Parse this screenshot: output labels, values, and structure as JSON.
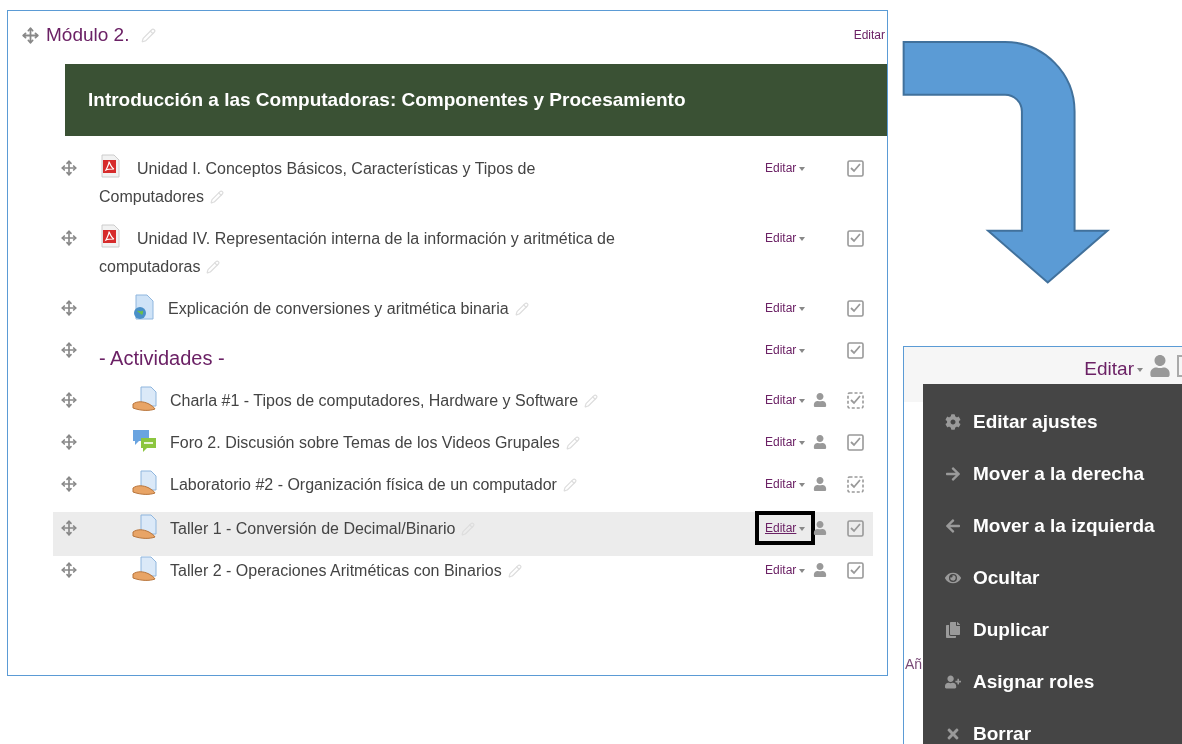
{
  "left_panel": {
    "section_title": "Módulo 2.",
    "edit_link": "Editar",
    "banner": "Introducción a las Computadoras: Componentes y Procesamiento",
    "activities": [
      {
        "kind": "pdf",
        "title": "Unidad I. Conceptos Básicos, Características y Tipos de Computadores",
        "indented": false,
        "edit": "Editar",
        "groups_icon": false,
        "dashed_check": false,
        "highlighted": false,
        "marked": false
      },
      {
        "kind": "pdf",
        "title": "Unidad IV. Representación interna de la información y aritmética de computadoras",
        "indented": false,
        "edit": "Editar",
        "groups_icon": false,
        "dashed_check": false,
        "highlighted": false,
        "marked": false
      },
      {
        "kind": "url",
        "title": "Explicación de conversiones y aritmética binaria",
        "indented": true,
        "edit": "Editar",
        "groups_icon": false,
        "dashed_check": false,
        "highlighted": false,
        "marked": false
      },
      {
        "kind": "label",
        "title": "- Actividades -",
        "indented": false,
        "edit": "Editar",
        "groups_icon": false,
        "dashed_check": false,
        "highlighted": false,
        "marked": false
      },
      {
        "kind": "assign",
        "title": "Charla #1 - Tipos de computadores, Hardware y Software",
        "indented": true,
        "edit": "Editar",
        "groups_icon": true,
        "dashed_check": true,
        "highlighted": false,
        "marked": false
      },
      {
        "kind": "forum",
        "title": "Foro 2. Discusión sobre Temas de los Videos Grupales",
        "indented": true,
        "edit": "Editar",
        "groups_icon": true,
        "dashed_check": false,
        "highlighted": false,
        "marked": false
      },
      {
        "kind": "assign",
        "title": "Laboratorio #2 - Organización física de un computador",
        "indented": true,
        "edit": "Editar",
        "groups_icon": true,
        "dashed_check": true,
        "highlighted": false,
        "marked": false
      },
      {
        "kind": "assign",
        "title": "Taller 1 - Conversión de Decimal/Binario",
        "indented": true,
        "edit": "Editar",
        "groups_icon": true,
        "dashed_check": false,
        "highlighted": true,
        "marked": true
      },
      {
        "kind": "assign",
        "title": "Taller 2 - Operaciones Aritméticas con Binarios",
        "indented": true,
        "edit": "Editar",
        "groups_icon": true,
        "dashed_check": false,
        "highlighted": false,
        "marked": false
      }
    ]
  },
  "right_panel": {
    "edit": "Editar",
    "background_text": "Añ",
    "menu": [
      {
        "kind": "gear",
        "label": "Editar ajustes"
      },
      {
        "kind": "right",
        "label": "Mover a la derecha"
      },
      {
        "kind": "left",
        "label": "Mover a la izquierda"
      },
      {
        "kind": "eye",
        "label": "Ocultar"
      },
      {
        "kind": "copy",
        "label": "Duplicar"
      },
      {
        "kind": "user-plus",
        "label": "Asignar roles"
      },
      {
        "kind": "delete",
        "label": "Borrar"
      }
    ]
  }
}
